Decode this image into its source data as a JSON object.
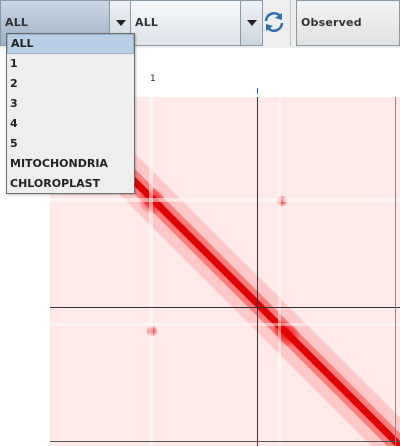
{
  "toolbar": {
    "chromosome_x": "ALL",
    "chromosome_y": "ALL",
    "display_mode": "Observed"
  },
  "dropdown": {
    "items": [
      {
        "label": "ALL",
        "selected": true
      },
      {
        "label": "1"
      },
      {
        "label": "2"
      },
      {
        "label": "3"
      },
      {
        "label": "4"
      },
      {
        "label": "5"
      },
      {
        "label": "MITOCHONDRIA"
      },
      {
        "label": "CHLOROPLAST"
      }
    ]
  },
  "heatmap": {
    "top_tick_label": "1",
    "colors": {
      "strong": "#e60000",
      "light": "#ffe8e8",
      "grid": "#333333"
    }
  },
  "icons": {
    "refresh": "refresh-icon",
    "dropdown_arrow": "chevron-down-icon"
  }
}
